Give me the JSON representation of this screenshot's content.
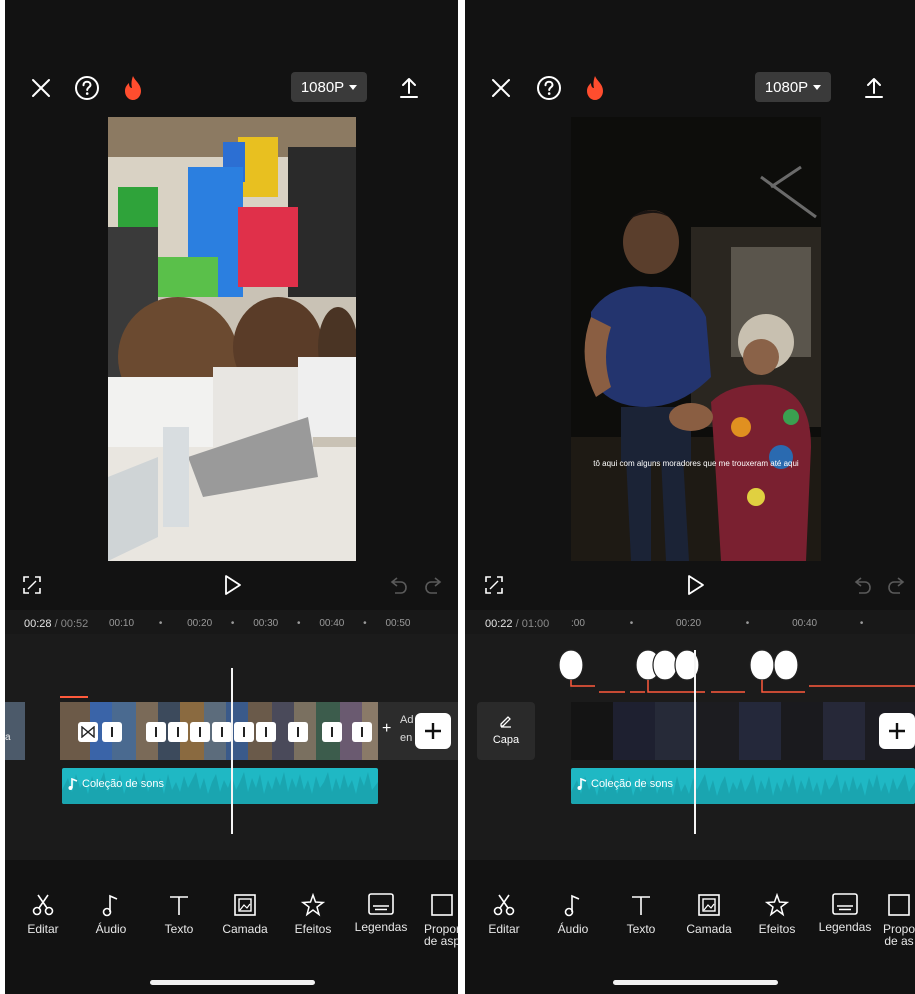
{
  "left": {
    "resolution": "1080P",
    "timecode_current": "00:28",
    "timecode_sep": "/",
    "timecode_total": "00:52",
    "ruler": [
      "00:10",
      "•",
      "00:20",
      "•",
      "00:30",
      "•",
      "00:40",
      "•",
      "00:50"
    ],
    "add_text_1": "Ad",
    "add_text_2": "en",
    "audio_label": "Coleção de sons",
    "clip_left_label": "a",
    "tools": [
      {
        "icon": "scissors-icon",
        "label": "Editar"
      },
      {
        "icon": "music-note-icon",
        "label": "Áudio"
      },
      {
        "icon": "text-icon",
        "label": "Texto"
      },
      {
        "icon": "layer-icon",
        "label": "Camada"
      },
      {
        "icon": "effects-icon",
        "label": "Efeitos"
      },
      {
        "icon": "captions-icon",
        "label": "Legendas"
      },
      {
        "icon": "aspect-icon",
        "label": "Propor",
        "label2": "de asp"
      }
    ]
  },
  "right": {
    "resolution": "1080P",
    "timecode_current": "00:22",
    "timecode_sep": "/",
    "timecode_total": "01:00",
    "ruler": [
      ":00",
      "•",
      "00:20",
      "•",
      "00:40",
      "•"
    ],
    "cover_label": "Capa",
    "subtitle": "tô aqui com alguns moradores que me trouxeram até aqui",
    "audio_label": "Coleção de sons",
    "tools": [
      {
        "icon": "scissors-icon",
        "label": "Editar"
      },
      {
        "icon": "music-note-icon",
        "label": "Áudio"
      },
      {
        "icon": "text-icon",
        "label": "Texto"
      },
      {
        "icon": "layer-icon",
        "label": "Camada"
      },
      {
        "icon": "effects-icon",
        "label": "Efeitos"
      },
      {
        "icon": "captions-icon",
        "label": "Legendas"
      },
      {
        "icon": "aspect-icon",
        "label": "Propo",
        "label2": "de as"
      }
    ]
  },
  "colors": {
    "accent_fire": "#ff4d2e",
    "wave": "#1fb8c4",
    "background": "#121212"
  }
}
